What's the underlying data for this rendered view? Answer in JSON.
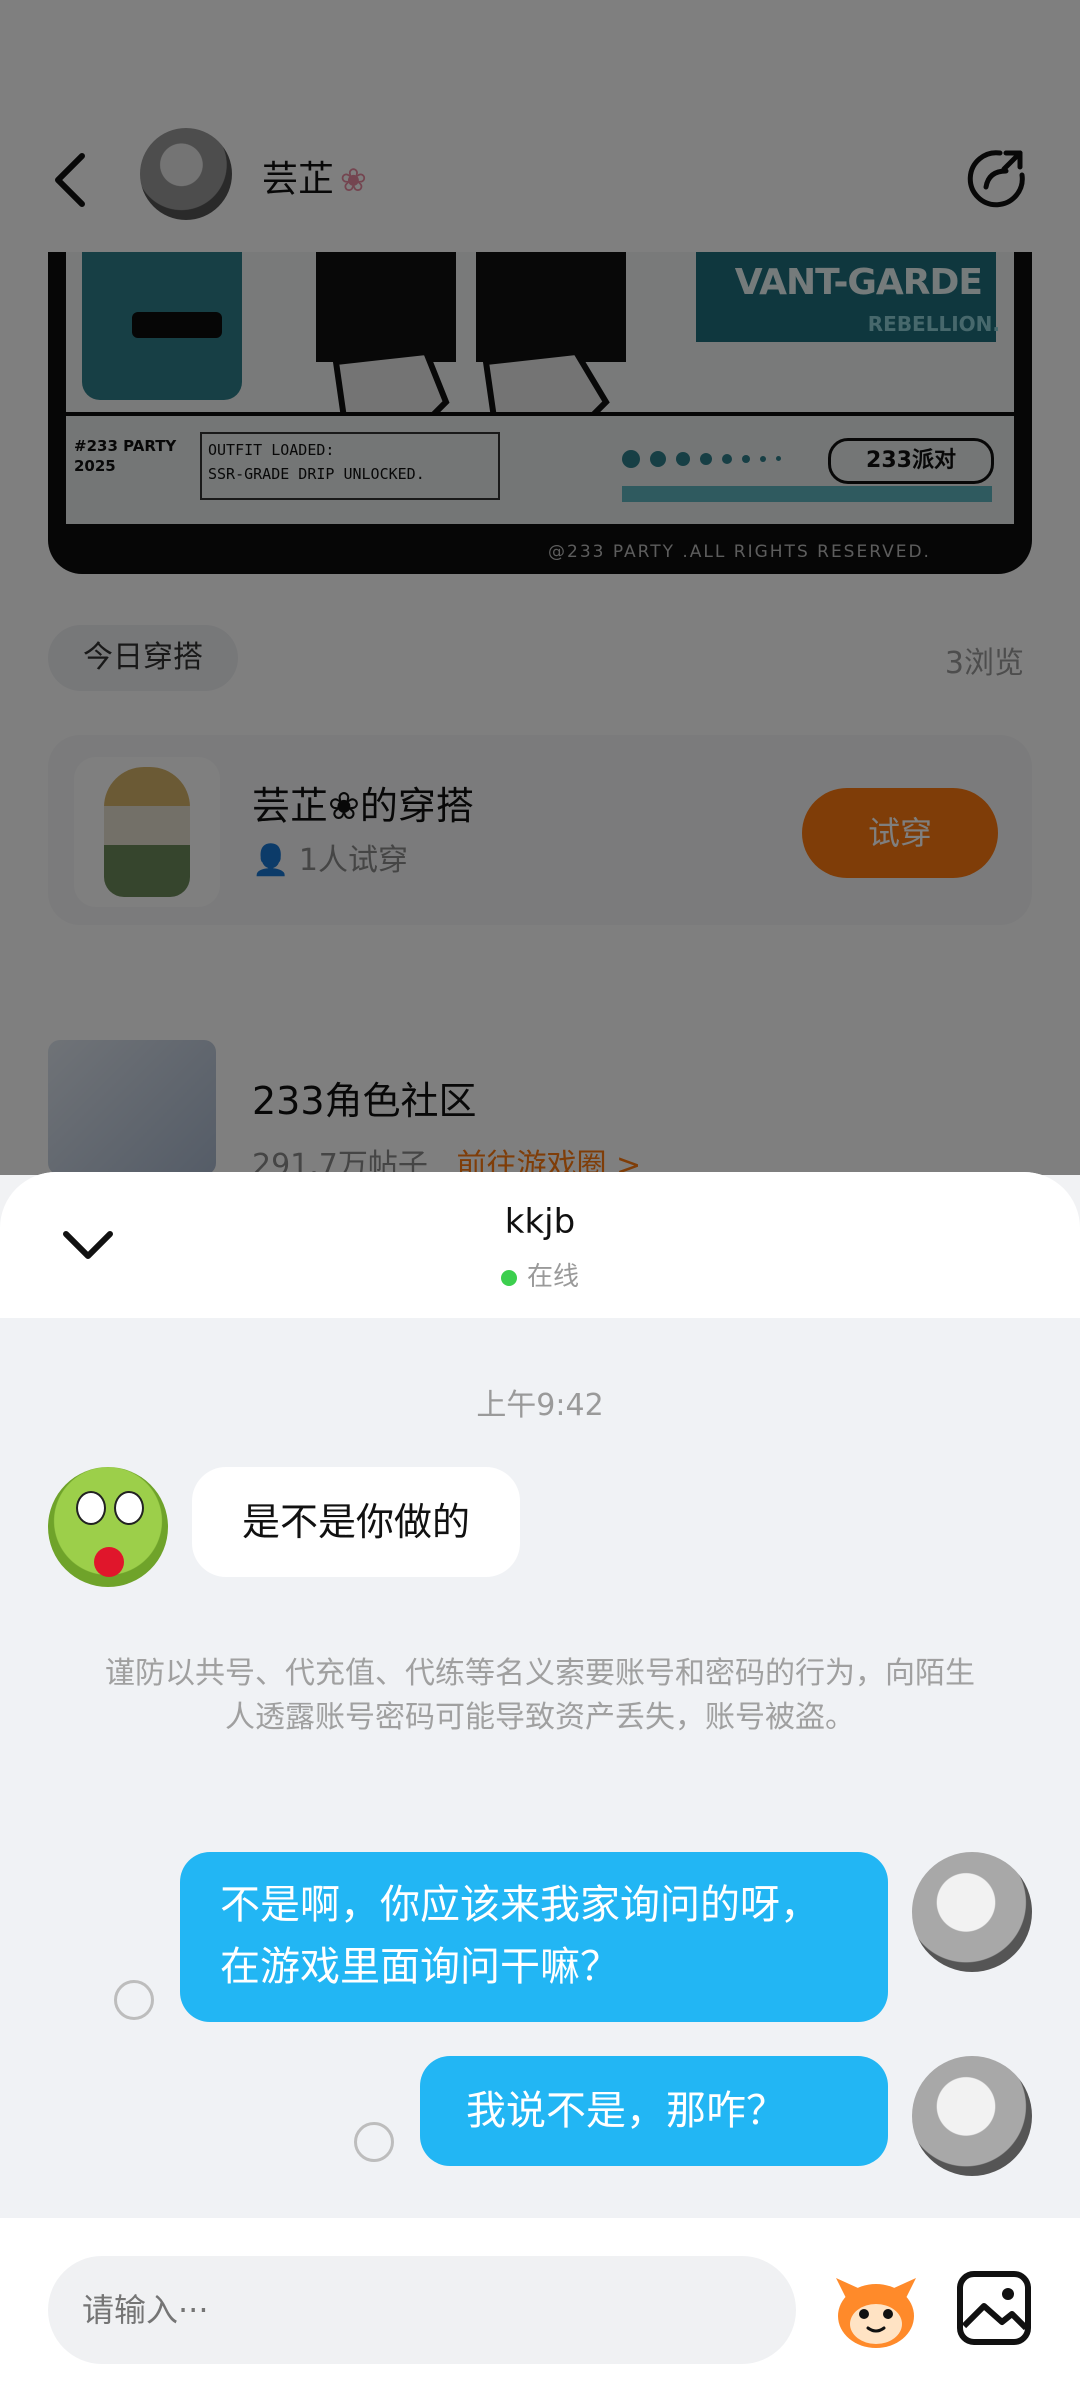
{
  "header": {
    "profile_name": "芸芷",
    "flower_glyph": "❀"
  },
  "banner": {
    "avant_title": "VANT-GARDE",
    "rebellion": "REBELLION.",
    "party_line1": "#233 PARTY",
    "party_line2": "2025",
    "outfit_line1": "OUTFIT LOADED:",
    "outfit_line2": "SSR-GRADE DRIP UNLOCKED.",
    "logo_text": "233派对",
    "footer": "@233 PARTY .ALL RIGHTS RESERVED."
  },
  "today": {
    "tag": "今日穿搭",
    "views": "3浏览"
  },
  "outfit": {
    "title": "芸芷❀的穿搭",
    "tried": "1人试穿",
    "try_button": "试穿"
  },
  "community": {
    "title": "233角色社区",
    "posts": "291.7万帖子",
    "link": "前往游戏圈 >"
  },
  "chat": {
    "name": "kkjb",
    "status": "在线",
    "timestamp": "上午9:42",
    "messages": [
      {
        "from": "other",
        "text": "是不是你做的"
      },
      {
        "from": "me",
        "text": "不是啊，你应该来我家询问的呀，在游戏里面询问干嘛？"
      },
      {
        "from": "me",
        "text": "我说不是，那咋？"
      }
    ],
    "warning": "谨防以共号、代充值、代练等名义索要账号和密码的行为，向陌生人透露账号密码可能导致资产丢失，账号被盗。"
  },
  "composer": {
    "placeholder": "请输入···"
  },
  "colors": {
    "accent_orange": "#ff7a10",
    "bubble_blue": "#22b6f4",
    "online_green": "#3ccf4e"
  }
}
